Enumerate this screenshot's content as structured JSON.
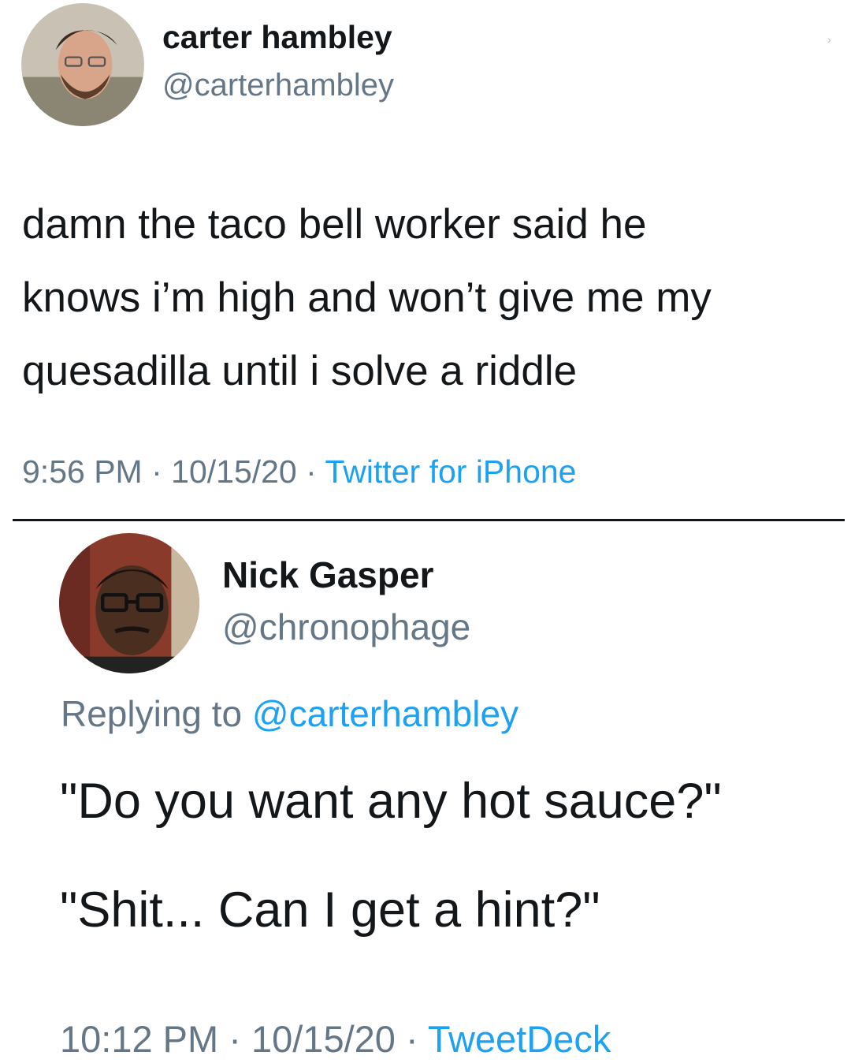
{
  "tweets": [
    {
      "name": "carter hambley",
      "handle": "@carterhambley",
      "text": "damn the taco bell worker said he\nknows i’m high and won’t give me my\nquesadilla until i solve a riddle",
      "time": "9:56 PM",
      "date": "10/15/20",
      "source": "Twitter for iPhone",
      "separator": " · "
    },
    {
      "name": "Nick Gasper",
      "handle": "@chronophage",
      "replying_prefix": "Replying to ",
      "replying_to": "@carterhambley",
      "lines": [
        "\"Do you want any hot sauce?\"",
        "\"Shit... Can I get a hint?\""
      ],
      "time": "10:12 PM",
      "date": "10/15/20",
      "source": "TweetDeck",
      "separator": " · "
    }
  ],
  "colors": {
    "text": "#14171a",
    "secondary": "#657786",
    "link": "#1da1f2"
  },
  "icons": {
    "more": "chevron-down-icon"
  }
}
